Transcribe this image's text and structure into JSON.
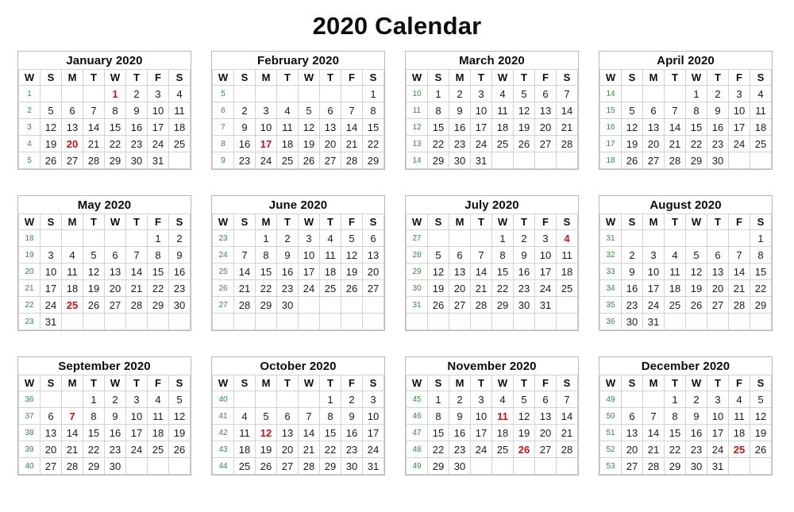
{
  "title": "2020 Calendar",
  "colors": {
    "week_number": "#2e8b45",
    "holiday": "#cc1111",
    "text": "#1a1a1a",
    "grid_line": "#d2d2d2",
    "outer_border": "#b8b8b8",
    "background": "#ffffff"
  },
  "weekday_headers": [
    "W",
    "S",
    "M",
    "T",
    "W",
    "T",
    "F",
    "S"
  ],
  "month_rows": [
    {
      "months": [
        {
          "name": "January 2020",
          "weeks": [
            {
              "w": "1",
              "days": [
                "",
                "",
                "",
                "1",
                "2",
                "3",
                "4"
              ],
              "holidays": [
                "1"
              ]
            },
            {
              "w": "2",
              "days": [
                "5",
                "6",
                "7",
                "8",
                "9",
                "10",
                "11"
              ],
              "holidays": []
            },
            {
              "w": "3",
              "days": [
                "12",
                "13",
                "14",
                "15",
                "16",
                "17",
                "18"
              ],
              "holidays": []
            },
            {
              "w": "4",
              "days": [
                "19",
                "20",
                "21",
                "22",
                "23",
                "24",
                "25"
              ],
              "holidays": [
                "20"
              ]
            },
            {
              "w": "5",
              "days": [
                "26",
                "27",
                "28",
                "29",
                "30",
                "31",
                ""
              ],
              "holidays": []
            }
          ]
        },
        {
          "name": "February 2020",
          "weeks": [
            {
              "w": "5",
              "days": [
                "",
                "",
                "",
                "",
                "",
                "",
                "1"
              ],
              "holidays": []
            },
            {
              "w": "6",
              "days": [
                "2",
                "3",
                "4",
                "5",
                "6",
                "7",
                "8"
              ],
              "holidays": []
            },
            {
              "w": "7",
              "days": [
                "9",
                "10",
                "11",
                "12",
                "13",
                "14",
                "15"
              ],
              "holidays": []
            },
            {
              "w": "8",
              "days": [
                "16",
                "17",
                "18",
                "19",
                "20",
                "21",
                "22"
              ],
              "holidays": [
                "17"
              ]
            },
            {
              "w": "9",
              "days": [
                "23",
                "24",
                "25",
                "26",
                "27",
                "28",
                "29"
              ],
              "holidays": []
            }
          ]
        },
        {
          "name": "March 2020",
          "weeks": [
            {
              "w": "10",
              "days": [
                "1",
                "2",
                "3",
                "4",
                "5",
                "6",
                "7"
              ],
              "holidays": []
            },
            {
              "w": "11",
              "days": [
                "8",
                "9",
                "10",
                "11",
                "12",
                "13",
                "14"
              ],
              "holidays": []
            },
            {
              "w": "12",
              "days": [
                "15",
                "16",
                "17",
                "18",
                "19",
                "20",
                "21"
              ],
              "holidays": []
            },
            {
              "w": "13",
              "days": [
                "22",
                "23",
                "24",
                "25",
                "26",
                "27",
                "28"
              ],
              "holidays": []
            },
            {
              "w": "14",
              "days": [
                "29",
                "30",
                "31",
                "",
                "",
                "",
                ""
              ],
              "holidays": []
            }
          ]
        },
        {
          "name": "April 2020",
          "weeks": [
            {
              "w": "14",
              "days": [
                "",
                "",
                "",
                "1",
                "2",
                "3",
                "4"
              ],
              "holidays": []
            },
            {
              "w": "15",
              "days": [
                "5",
                "6",
                "7",
                "8",
                "9",
                "10",
                "11"
              ],
              "holidays": []
            },
            {
              "w": "16",
              "days": [
                "12",
                "13",
                "14",
                "15",
                "16",
                "17",
                "18"
              ],
              "holidays": []
            },
            {
              "w": "17",
              "days": [
                "19",
                "20",
                "21",
                "22",
                "23",
                "24",
                "25"
              ],
              "holidays": []
            },
            {
              "w": "18",
              "days": [
                "26",
                "27",
                "28",
                "29",
                "30",
                "",
                ""
              ],
              "holidays": []
            }
          ]
        }
      ]
    },
    {
      "months": [
        {
          "name": "May 2020",
          "weeks": [
            {
              "w": "18",
              "days": [
                "",
                "",
                "",
                "",
                "",
                "1",
                "2"
              ],
              "holidays": []
            },
            {
              "w": "19",
              "days": [
                "3",
                "4",
                "5",
                "6",
                "7",
                "8",
                "9"
              ],
              "holidays": []
            },
            {
              "w": "20",
              "days": [
                "10",
                "11",
                "12",
                "13",
                "14",
                "15",
                "16"
              ],
              "holidays": []
            },
            {
              "w": "21",
              "days": [
                "17",
                "18",
                "19",
                "20",
                "21",
                "22",
                "23"
              ],
              "holidays": []
            },
            {
              "w": "22",
              "days": [
                "24",
                "25",
                "26",
                "27",
                "28",
                "29",
                "30"
              ],
              "holidays": [
                "25"
              ]
            },
            {
              "w": "23",
              "days": [
                "31",
                "",
                "",
                "",
                "",
                "",
                ""
              ],
              "holidays": []
            }
          ]
        },
        {
          "name": "June 2020",
          "weeks": [
            {
              "w": "23",
              "days": [
                "",
                "1",
                "2",
                "3",
                "4",
                "5",
                "6"
              ],
              "holidays": []
            },
            {
              "w": "24",
              "days": [
                "7",
                "8",
                "9",
                "10",
                "11",
                "12",
                "13"
              ],
              "holidays": []
            },
            {
              "w": "25",
              "days": [
                "14",
                "15",
                "16",
                "17",
                "18",
                "19",
                "20"
              ],
              "holidays": []
            },
            {
              "w": "26",
              "days": [
                "21",
                "22",
                "23",
                "24",
                "25",
                "26",
                "27"
              ],
              "holidays": []
            },
            {
              "w": "27",
              "days": [
                "28",
                "29",
                "30",
                "",
                "",
                "",
                ""
              ],
              "holidays": []
            },
            {
              "w": "",
              "days": [
                "",
                "",
                "",
                "",
                "",
                "",
                ""
              ],
              "holidays": []
            }
          ]
        },
        {
          "name": "July 2020",
          "weeks": [
            {
              "w": "27",
              "days": [
                "",
                "",
                "",
                "1",
                "2",
                "3",
                "4"
              ],
              "holidays": [
                "4"
              ]
            },
            {
              "w": "28",
              "days": [
                "5",
                "6",
                "7",
                "8",
                "9",
                "10",
                "11"
              ],
              "holidays": []
            },
            {
              "w": "29",
              "days": [
                "12",
                "13",
                "14",
                "15",
                "16",
                "17",
                "18"
              ],
              "holidays": []
            },
            {
              "w": "30",
              "days": [
                "19",
                "20",
                "21",
                "22",
                "23",
                "24",
                "25"
              ],
              "holidays": []
            },
            {
              "w": "31",
              "days": [
                "26",
                "27",
                "28",
                "29",
                "30",
                "31",
                ""
              ],
              "holidays": []
            },
            {
              "w": "",
              "days": [
                "",
                "",
                "",
                "",
                "",
                "",
                ""
              ],
              "holidays": []
            }
          ]
        },
        {
          "name": "August 2020",
          "weeks": [
            {
              "w": "31",
              "days": [
                "",
                "",
                "",
                "",
                "",
                "",
                "1"
              ],
              "holidays": []
            },
            {
              "w": "32",
              "days": [
                "2",
                "3",
                "4",
                "5",
                "6",
                "7",
                "8"
              ],
              "holidays": []
            },
            {
              "w": "33",
              "days": [
                "9",
                "10",
                "11",
                "12",
                "13",
                "14",
                "15"
              ],
              "holidays": []
            },
            {
              "w": "34",
              "days": [
                "16",
                "17",
                "18",
                "19",
                "20",
                "21",
                "22"
              ],
              "holidays": []
            },
            {
              "w": "35",
              "days": [
                "23",
                "24",
                "25",
                "26",
                "27",
                "28",
                "29"
              ],
              "holidays": []
            },
            {
              "w": "36",
              "days": [
                "30",
                "31",
                "",
                "",
                "",
                "",
                ""
              ],
              "holidays": []
            }
          ]
        }
      ]
    },
    {
      "months": [
        {
          "name": "September 2020",
          "weeks": [
            {
              "w": "36",
              "days": [
                "",
                "",
                "1",
                "2",
                "3",
                "4",
                "5"
              ],
              "holidays": []
            },
            {
              "w": "37",
              "days": [
                "6",
                "7",
                "8",
                "9",
                "10",
                "11",
                "12"
              ],
              "holidays": [
                "7"
              ]
            },
            {
              "w": "38",
              "days": [
                "13",
                "14",
                "15",
                "16",
                "17",
                "18",
                "19"
              ],
              "holidays": []
            },
            {
              "w": "39",
              "days": [
                "20",
                "21",
                "22",
                "23",
                "24",
                "25",
                "26"
              ],
              "holidays": []
            },
            {
              "w": "40",
              "days": [
                "27",
                "28",
                "29",
                "30",
                "",
                "",
                ""
              ],
              "holidays": []
            }
          ]
        },
        {
          "name": "October 2020",
          "weeks": [
            {
              "w": "40",
              "days": [
                "",
                "",
                "",
                "",
                "1",
                "2",
                "3"
              ],
              "holidays": []
            },
            {
              "w": "41",
              "days": [
                "4",
                "5",
                "6",
                "7",
                "8",
                "9",
                "10"
              ],
              "holidays": []
            },
            {
              "w": "42",
              "days": [
                "11",
                "12",
                "13",
                "14",
                "15",
                "16",
                "17"
              ],
              "holidays": [
                "12"
              ]
            },
            {
              "w": "43",
              "days": [
                "18",
                "19",
                "20",
                "21",
                "22",
                "23",
                "24"
              ],
              "holidays": []
            },
            {
              "w": "44",
              "days": [
                "25",
                "26",
                "27",
                "28",
                "29",
                "30",
                "31"
              ],
              "holidays": []
            }
          ]
        },
        {
          "name": "November 2020",
          "weeks": [
            {
              "w": "45",
              "days": [
                "1",
                "2",
                "3",
                "4",
                "5",
                "6",
                "7"
              ],
              "holidays": []
            },
            {
              "w": "46",
              "days": [
                "8",
                "9",
                "10",
                "11",
                "12",
                "13",
                "14"
              ],
              "holidays": [
                "11"
              ]
            },
            {
              "w": "47",
              "days": [
                "15",
                "16",
                "17",
                "18",
                "19",
                "20",
                "21"
              ],
              "holidays": []
            },
            {
              "w": "48",
              "days": [
                "22",
                "23",
                "24",
                "25",
                "26",
                "27",
                "28"
              ],
              "holidays": [
                "26"
              ]
            },
            {
              "w": "49",
              "days": [
                "29",
                "30",
                "",
                "",
                "",
                "",
                ""
              ],
              "holidays": []
            }
          ]
        },
        {
          "name": "December 2020",
          "weeks": [
            {
              "w": "49",
              "days": [
                "",
                "",
                "1",
                "2",
                "3",
                "4",
                "5"
              ],
              "holidays": []
            },
            {
              "w": "50",
              "days": [
                "6",
                "7",
                "8",
                "9",
                "10",
                "11",
                "12"
              ],
              "holidays": []
            },
            {
              "w": "51",
              "days": [
                "13",
                "14",
                "15",
                "16",
                "17",
                "18",
                "19"
              ],
              "holidays": []
            },
            {
              "w": "52",
              "days": [
                "20",
                "21",
                "22",
                "23",
                "24",
                "25",
                "26"
              ],
              "holidays": [
                "25"
              ]
            },
            {
              "w": "53",
              "days": [
                "27",
                "28",
                "29",
                "30",
                "31",
                "",
                ""
              ],
              "holidays": []
            }
          ]
        }
      ]
    }
  ]
}
